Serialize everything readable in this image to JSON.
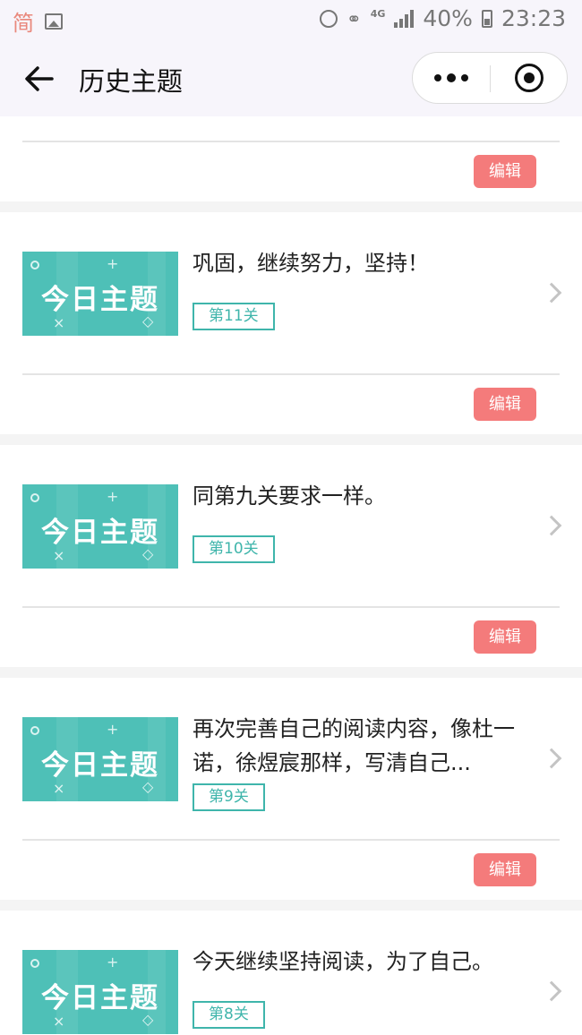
{
  "status_bar": {
    "left_char": "简",
    "network": "4G",
    "battery": "40%",
    "time": "23:23",
    "icons": [
      "image-icon",
      "alarm-icon",
      "wifi-icon",
      "signal-icon",
      "battery-icon"
    ]
  },
  "nav": {
    "title": "历史主题",
    "icons": [
      "back-arrow-icon",
      "more-dots-icon",
      "close-target-icon"
    ]
  },
  "colors": {
    "accent_teal": "#3fb5ab",
    "thumbnail_bg": "#4ec0b7",
    "edit_button_bg": "#f47b7b"
  },
  "edit_label": "编辑",
  "thumbnail_text": "今日主题",
  "entries": [
    {
      "desc": "巩固，继续努力，坚持！",
      "level": "第11关"
    },
    {
      "desc": "同第九关要求一样。",
      "level": "第10关"
    },
    {
      "desc": "再次完善自己的阅读内容，像杜一诺，徐煜宸那样，写清自己...",
      "level": "第9关"
    },
    {
      "desc": "今天继续坚持阅读，为了自己。",
      "level": "第8关"
    }
  ]
}
